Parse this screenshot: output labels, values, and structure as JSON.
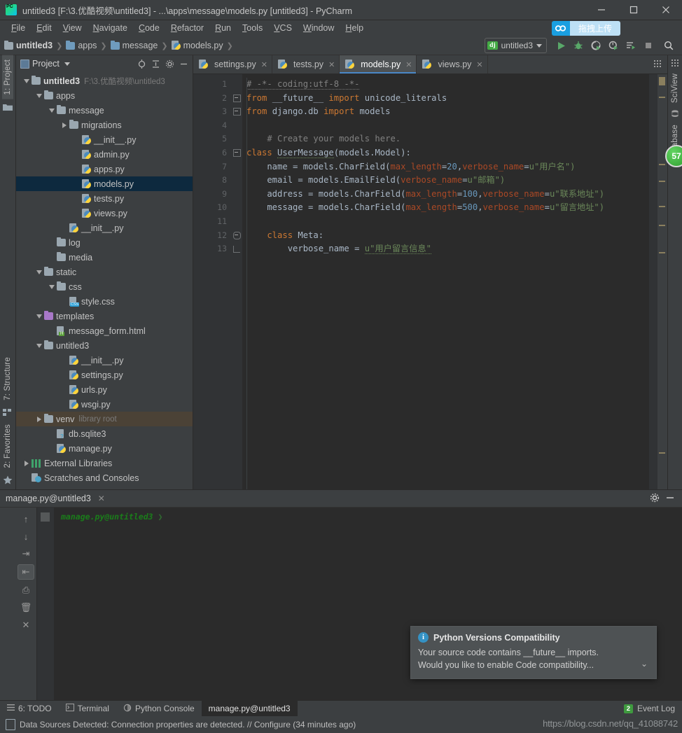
{
  "window": {
    "title": "untitled3 [F:\\3.优酷视频\\untitled3] - ...\\apps\\message\\models.py [untitled3] - PyCharm",
    "app_icon": "pycharm-logo-icon",
    "minimize": "—",
    "maximize": "▢",
    "close": "✕"
  },
  "menubar": {
    "items": [
      {
        "label": "File"
      },
      {
        "label": "Edit"
      },
      {
        "label": "View"
      },
      {
        "label": "Navigate"
      },
      {
        "label": "Code"
      },
      {
        "label": "Refactor"
      },
      {
        "label": "Run"
      },
      {
        "label": "Tools"
      },
      {
        "label": "VCS"
      },
      {
        "label": "Window"
      },
      {
        "label": "Help"
      }
    ],
    "upload_button": {
      "label": "拖拽上传",
      "icon": "cloud-upload-icon",
      "accent": "#1a9fe0"
    }
  },
  "breadcrumb": {
    "items": [
      {
        "label": "untitled3",
        "icon": "folder-icon",
        "bold": true
      },
      {
        "label": "apps",
        "icon": "folder-icon",
        "bold": false
      },
      {
        "label": "message",
        "icon": "folder-icon",
        "bold": false
      },
      {
        "label": "models.py",
        "icon": "python-file-icon",
        "bold": false
      }
    ],
    "separator": "❯"
  },
  "run_toolbar": {
    "config_name": "untitled3",
    "config_badge": "dj",
    "caret": "▾",
    "buttons": [
      {
        "name": "run-button",
        "icon": "play-icon"
      },
      {
        "name": "debug-button",
        "icon": "bug-icon"
      },
      {
        "name": "run-with-coverage-button",
        "icon": "coverage-icon"
      },
      {
        "name": "profile-button",
        "icon": "profile-icon"
      },
      {
        "name": "attach-button",
        "icon": "attach-icon"
      },
      {
        "name": "stop-button",
        "icon": "stop-icon"
      },
      {
        "name": "search-everywhere-button",
        "icon": "search-icon"
      }
    ]
  },
  "left_strip": {
    "tabs": [
      {
        "label": "1: Project",
        "active": true
      },
      {
        "label": "7: Structure",
        "active": false
      },
      {
        "label": "2: Favorites",
        "active": false
      }
    ]
  },
  "right_strip": {
    "tabs": [
      {
        "label": "SciView"
      },
      {
        "label": "Database"
      }
    ],
    "badge": "57"
  },
  "project_panel": {
    "title": "Project",
    "caret": "▾",
    "actions": [
      {
        "name": "target-icon",
        "glyph": "⊙"
      },
      {
        "name": "collapse-all-icon",
        "glyph": "⇳"
      },
      {
        "name": "settings-gear-icon",
        "glyph": "✿"
      },
      {
        "name": "hide-panel-icon",
        "glyph": "—"
      }
    ],
    "tree": [
      {
        "label": "untitled3",
        "sub": "F:\\3.优酷视频\\untitled3",
        "indent": 0,
        "twisty": "down",
        "icon": "folder-icon",
        "bold": true,
        "state": "normal"
      },
      {
        "label": "apps",
        "sub": "",
        "indent": 1,
        "twisty": "down",
        "icon": "folder-icon",
        "bold": false,
        "state": "normal"
      },
      {
        "label": "message",
        "sub": "",
        "indent": 2,
        "twisty": "down",
        "icon": "folder-icon",
        "bold": false,
        "state": "normal"
      },
      {
        "label": "migrations",
        "sub": "",
        "indent": 3,
        "twisty": "right",
        "icon": "folder-icon",
        "bold": false,
        "state": "normal"
      },
      {
        "label": "__init__.py",
        "sub": "",
        "indent": 4,
        "twisty": "none",
        "icon": "python-file-icon",
        "bold": false,
        "state": "normal"
      },
      {
        "label": "admin.py",
        "sub": "",
        "indent": 4,
        "twisty": "none",
        "icon": "python-file-icon",
        "bold": false,
        "state": "normal"
      },
      {
        "label": "apps.py",
        "sub": "",
        "indent": 4,
        "twisty": "none",
        "icon": "python-file-icon",
        "bold": false,
        "state": "normal"
      },
      {
        "label": "models.py",
        "sub": "",
        "indent": 4,
        "twisty": "none",
        "icon": "python-file-icon",
        "bold": false,
        "state": "selected"
      },
      {
        "label": "tests.py",
        "sub": "",
        "indent": 4,
        "twisty": "none",
        "icon": "python-file-icon",
        "bold": false,
        "state": "normal"
      },
      {
        "label": "views.py",
        "sub": "",
        "indent": 4,
        "twisty": "none",
        "icon": "python-file-icon",
        "bold": false,
        "state": "normal"
      },
      {
        "label": "__init__.py",
        "sub": "",
        "indent": 3,
        "twisty": "none",
        "icon": "python-file-icon",
        "bold": false,
        "state": "normal"
      },
      {
        "label": "log",
        "sub": "",
        "indent": 2,
        "twisty": "none",
        "icon": "folder-icon",
        "bold": false,
        "state": "normal"
      },
      {
        "label": "media",
        "sub": "",
        "indent": 2,
        "twisty": "none",
        "icon": "folder-icon",
        "bold": false,
        "state": "normal"
      },
      {
        "label": "static",
        "sub": "",
        "indent": 1,
        "twisty": "down",
        "icon": "folder-icon",
        "bold": false,
        "state": "normal"
      },
      {
        "label": "css",
        "sub": "",
        "indent": 2,
        "twisty": "down",
        "icon": "folder-icon",
        "bold": false,
        "state": "normal"
      },
      {
        "label": "style.css",
        "sub": "",
        "indent": 3,
        "twisty": "none",
        "icon": "css-file-icon",
        "bold": false,
        "state": "normal"
      },
      {
        "label": "templates",
        "sub": "",
        "indent": 1,
        "twisty": "down",
        "icon": "folder-purple-icon",
        "bold": false,
        "state": "normal"
      },
      {
        "label": "message_form.html",
        "sub": "",
        "indent": 2,
        "twisty": "none",
        "icon": "html-file-icon",
        "bold": false,
        "state": "normal"
      },
      {
        "label": "untitled3",
        "sub": "",
        "indent": 1,
        "twisty": "down",
        "icon": "folder-icon",
        "bold": false,
        "state": "normal"
      },
      {
        "label": "__init__.py",
        "sub": "",
        "indent": 3,
        "twisty": "none",
        "icon": "python-file-icon",
        "bold": false,
        "state": "normal"
      },
      {
        "label": "settings.py",
        "sub": "",
        "indent": 3,
        "twisty": "none",
        "icon": "python-file-icon",
        "bold": false,
        "state": "normal"
      },
      {
        "label": "urls.py",
        "sub": "",
        "indent": 3,
        "twisty": "none",
        "icon": "python-file-icon",
        "bold": false,
        "state": "normal"
      },
      {
        "label": "wsgi.py",
        "sub": "",
        "indent": 3,
        "twisty": "none",
        "icon": "python-file-icon",
        "bold": false,
        "state": "normal"
      },
      {
        "label": "venv",
        "sub": "library root",
        "indent": 1,
        "twisty": "right",
        "icon": "folder-icon",
        "bold": false,
        "state": "highlight"
      },
      {
        "label": "db.sqlite3",
        "sub": "",
        "indent": 2,
        "twisty": "none",
        "icon": "db-file-icon",
        "bold": false,
        "state": "normal"
      },
      {
        "label": "manage.py",
        "sub": "",
        "indent": 2,
        "twisty": "none",
        "icon": "python-file-icon",
        "bold": false,
        "state": "normal"
      },
      {
        "label": "External Libraries",
        "sub": "",
        "indent": 0,
        "twisty": "right",
        "icon": "library-icon",
        "bold": false,
        "state": "normal"
      },
      {
        "label": "Scratches and Consoles",
        "sub": "",
        "indent": 0,
        "twisty": "none",
        "icon": "scratches-icon",
        "bold": false,
        "state": "normal"
      }
    ]
  },
  "editor": {
    "tabs": [
      {
        "label": "settings.py",
        "icon": "python-file-icon",
        "active": false,
        "close": "✕"
      },
      {
        "label": "tests.py",
        "icon": "python-file-icon",
        "active": false,
        "close": "✕"
      },
      {
        "label": "models.py",
        "icon": "python-file-icon",
        "active": true,
        "close": "✕"
      },
      {
        "label": "views.py",
        "icon": "python-file-icon",
        "active": false,
        "close": "✕"
      }
    ],
    "line_numbers": [
      "1",
      "2",
      "3",
      "4",
      "5",
      "6",
      "7",
      "8",
      "9",
      "10",
      "11",
      "12",
      "13"
    ],
    "lines": [
      {
        "n": 1,
        "fold": "none",
        "tokens": [
          {
            "t": "# -*- coding:utf-8 -*-",
            "c": "cm ul-grey"
          }
        ]
      },
      {
        "n": 2,
        "fold": "minus",
        "tokens": [
          {
            "t": "from",
            "c": "k"
          },
          {
            "t": " __future__ ",
            "c": "fn"
          },
          {
            "t": "import",
            "c": "k"
          },
          {
            "t": " unicode_literals",
            "c": "fn"
          }
        ]
      },
      {
        "n": 3,
        "fold": "minus2",
        "tokens": [
          {
            "t": "from",
            "c": "k"
          },
          {
            "t": " django.db ",
            "c": "fn"
          },
          {
            "t": "import",
            "c": "k"
          },
          {
            "t": " models",
            "c": "fn"
          }
        ]
      },
      {
        "n": 4,
        "fold": "none",
        "tokens": []
      },
      {
        "n": 5,
        "fold": "none",
        "tokens": [
          {
            "t": "    # Create your models here.",
            "c": "cm"
          }
        ]
      },
      {
        "n": 6,
        "fold": "minus",
        "tokens": [
          {
            "t": "class",
            "c": "k"
          },
          {
            "t": " ",
            "c": "fn"
          },
          {
            "t": "UserMessage",
            "c": "cls ul-wave"
          },
          {
            "t": "(models.Model):",
            "c": "fn"
          }
        ]
      },
      {
        "n": 7,
        "fold": "none",
        "tokens": [
          {
            "t": "    name = models.CharField(",
            "c": "fn"
          },
          {
            "t": "max_length",
            "c": "kwarg"
          },
          {
            "t": "=",
            "c": "fn"
          },
          {
            "t": "20",
            "c": "num"
          },
          {
            "t": ",",
            "c": "fn"
          },
          {
            "t": "verbose_name",
            "c": "kwarg"
          },
          {
            "t": "=",
            "c": "fn"
          },
          {
            "t": "u\"用户名\")",
            "c": "str"
          }
        ]
      },
      {
        "n": 8,
        "fold": "none",
        "tokens": [
          {
            "t": "    email = models.EmailField(",
            "c": "fn"
          },
          {
            "t": "verbose_name",
            "c": "kwarg"
          },
          {
            "t": "=",
            "c": "fn"
          },
          {
            "t": "u\"邮箱\")",
            "c": "str"
          }
        ]
      },
      {
        "n": 9,
        "fold": "none",
        "tokens": [
          {
            "t": "    address = models.CharField(",
            "c": "fn"
          },
          {
            "t": "max_length",
            "c": "kwarg"
          },
          {
            "t": "=",
            "c": "fn"
          },
          {
            "t": "100",
            "c": "num"
          },
          {
            "t": ",",
            "c": "fn"
          },
          {
            "t": "verbose_name",
            "c": "kwarg"
          },
          {
            "t": "=",
            "c": "fn"
          },
          {
            "t": "u\"联系地址\")",
            "c": "str"
          }
        ]
      },
      {
        "n": 10,
        "fold": "none",
        "tokens": [
          {
            "t": "    message = models.CharField(",
            "c": "fn"
          },
          {
            "t": "max_length",
            "c": "kwarg"
          },
          {
            "t": "=",
            "c": "fn"
          },
          {
            "t": "500",
            "c": "num"
          },
          {
            "t": ",",
            "c": "fn"
          },
          {
            "t": "verbose_name",
            "c": "kwarg"
          },
          {
            "t": "=",
            "c": "fn"
          },
          {
            "t": "u\"留言地址\")",
            "c": "str"
          }
        ]
      },
      {
        "n": 11,
        "fold": "none",
        "tokens": []
      },
      {
        "n": 12,
        "fold": "round",
        "tokens": [
          {
            "t": "    class",
            "c": "k"
          },
          {
            "t": " Meta:",
            "c": "fn"
          }
        ]
      },
      {
        "n": 13,
        "fold": "end",
        "tokens": [
          {
            "t": "        verbose_name = ",
            "c": "fn"
          },
          {
            "t": "u\"用户留言信息\"",
            "c": "str ul-wave"
          }
        ]
      }
    ]
  },
  "console": {
    "tab_label": "manage.py@untitled3",
    "tab_close": "✕",
    "actions": [
      {
        "name": "console-settings-icon",
        "glyph": "✿"
      },
      {
        "name": "hide-console-icon",
        "glyph": "—"
      }
    ],
    "tools": [
      {
        "name": "up-arrow-icon",
        "glyph": "↑",
        "boxed": false
      },
      {
        "name": "down-arrow-icon",
        "glyph": "↓",
        "boxed": false
      },
      {
        "name": "soft-wrap-icon",
        "glyph": "⇥",
        "boxed": false
      },
      {
        "name": "scroll-to-end-icon",
        "glyph": "⇤",
        "boxed": true
      },
      {
        "name": "print-icon",
        "glyph": "⎙",
        "boxed": false
      },
      {
        "name": "clear-all-icon",
        "glyph": "🗑",
        "boxed": false
      },
      {
        "name": "close-icon",
        "glyph": "✕",
        "boxed": false
      }
    ],
    "prompt": "manage.py@untitled3",
    "prompt_chevron": "❯"
  },
  "notification": {
    "icon": "info-icon",
    "title": "Python Versions Compatibility",
    "line1": "Your source code contains __future__ imports.",
    "line2": "Would you like to enable Code compatibility...",
    "chevron": "⌄"
  },
  "toolwindow_bar": {
    "items": [
      {
        "label": "6: TODO",
        "icon": "todo-icon",
        "active": false
      },
      {
        "label": "Terminal",
        "icon": "terminal-icon",
        "active": false
      },
      {
        "label": "Python Console",
        "icon": "python-console-icon",
        "active": false
      },
      {
        "label": "manage.py@untitled3",
        "icon": "none",
        "active": true
      }
    ],
    "event_log": {
      "label": "Event Log",
      "count": "2"
    }
  },
  "statusbar": {
    "icon": "note-icon",
    "message": "Data Sources Detected: Connection properties are detected. // Configure (34 minutes ago)",
    "watermark": "https://blog.csdn.net/qq_41088742"
  }
}
